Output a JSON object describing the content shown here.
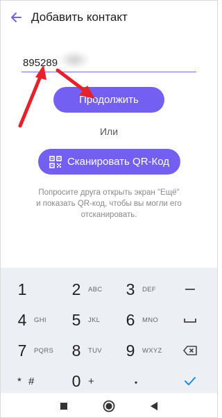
{
  "header": {
    "title": "Добавить контакт",
    "back_icon": "back-arrow-icon"
  },
  "phone_input": {
    "value": "895289",
    "placeholder": ""
  },
  "continue_button": {
    "label": "Продолжить"
  },
  "or_label": "Или",
  "qr_button": {
    "label": "Сканировать QR-Код",
    "icon": "qr-code-icon"
  },
  "hint": {
    "lines": [
      "Попросите друга открыть экран \"Ещё\"",
      "и показать QR-код, чтобы вы могли его",
      "отсканировать."
    ]
  },
  "keypad": {
    "rows": [
      [
        {
          "digit": "1",
          "letters": ""
        },
        {
          "digit": "2",
          "letters": "ABC"
        },
        {
          "digit": "3",
          "letters": "DEF"
        },
        {
          "func": "minus-icon"
        }
      ],
      [
        {
          "digit": "4",
          "letters": "GHI"
        },
        {
          "digit": "5",
          "letters": "JKL"
        },
        {
          "digit": "6",
          "letters": "MNO"
        },
        {
          "func": "space-icon"
        }
      ],
      [
        {
          "digit": "7",
          "letters": "PQRS"
        },
        {
          "digit": "8",
          "letters": "TUV"
        },
        {
          "digit": "9",
          "letters": "WXYZ"
        },
        {
          "func": "backspace-icon"
        }
      ],
      [
        {
          "sym": "* #"
        },
        {
          "digit": "0",
          "letters": "+"
        },
        {
          "func": "dot-icon"
        },
        {
          "func": "checkmark-icon"
        }
      ]
    ]
  },
  "colors": {
    "accent": "#7360f2",
    "annotation_arrow": "#e5212b",
    "keypad_bg": "#eceff3",
    "check_color": "#1e88e5"
  },
  "navbar": {
    "buttons": [
      "recents-square-icon",
      "home-circle-icon",
      "back-triangle-icon"
    ]
  }
}
